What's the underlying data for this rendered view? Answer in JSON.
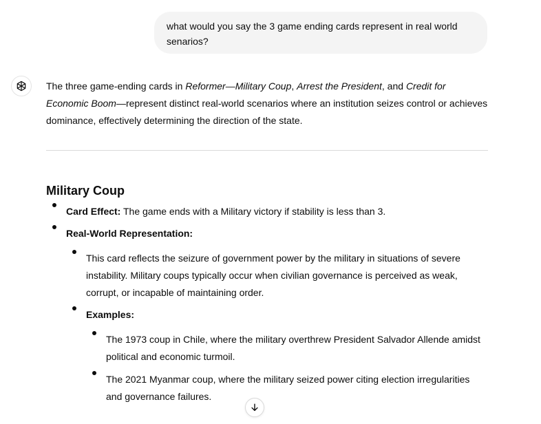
{
  "user_message": "what would you say the 3 game ending cards represent in real world senarios?",
  "intro": {
    "p1": "The three game-ending cards in ",
    "card1": "Reformer—Military Coup",
    "sep1": ", ",
    "card2": "Arrest the President",
    "sep2": ", and ",
    "card3": "Credit for Economic Boom",
    "p2": "—represent distinct real-world scenarios where an institution seizes control or achieves dominance, effectively determining the direction of the state."
  },
  "section": {
    "title": "Military Coup",
    "card_effect_label": "Card Effect:",
    "card_effect_text": " The game ends with a Military victory if stability is less than 3.",
    "real_world_label": "Real-World Representation:",
    "real_world_text": "This card reflects the seizure of government power by the military in situations of severe instability. Military coups typically occur when civilian governance is perceived as weak, corrupt, or incapable of maintaining order.",
    "examples_label": "Examples:",
    "examples": [
      "The 1973 coup in Chile, where the military overthrew President Salvador Allende amidst political and economic turmoil.",
      "The 2021 Myanmar coup, where the military seized power citing election irregularities and governance failures."
    ]
  },
  "icons": {
    "avatar": "openai-logo-icon",
    "scroll": "arrow-down-icon"
  }
}
